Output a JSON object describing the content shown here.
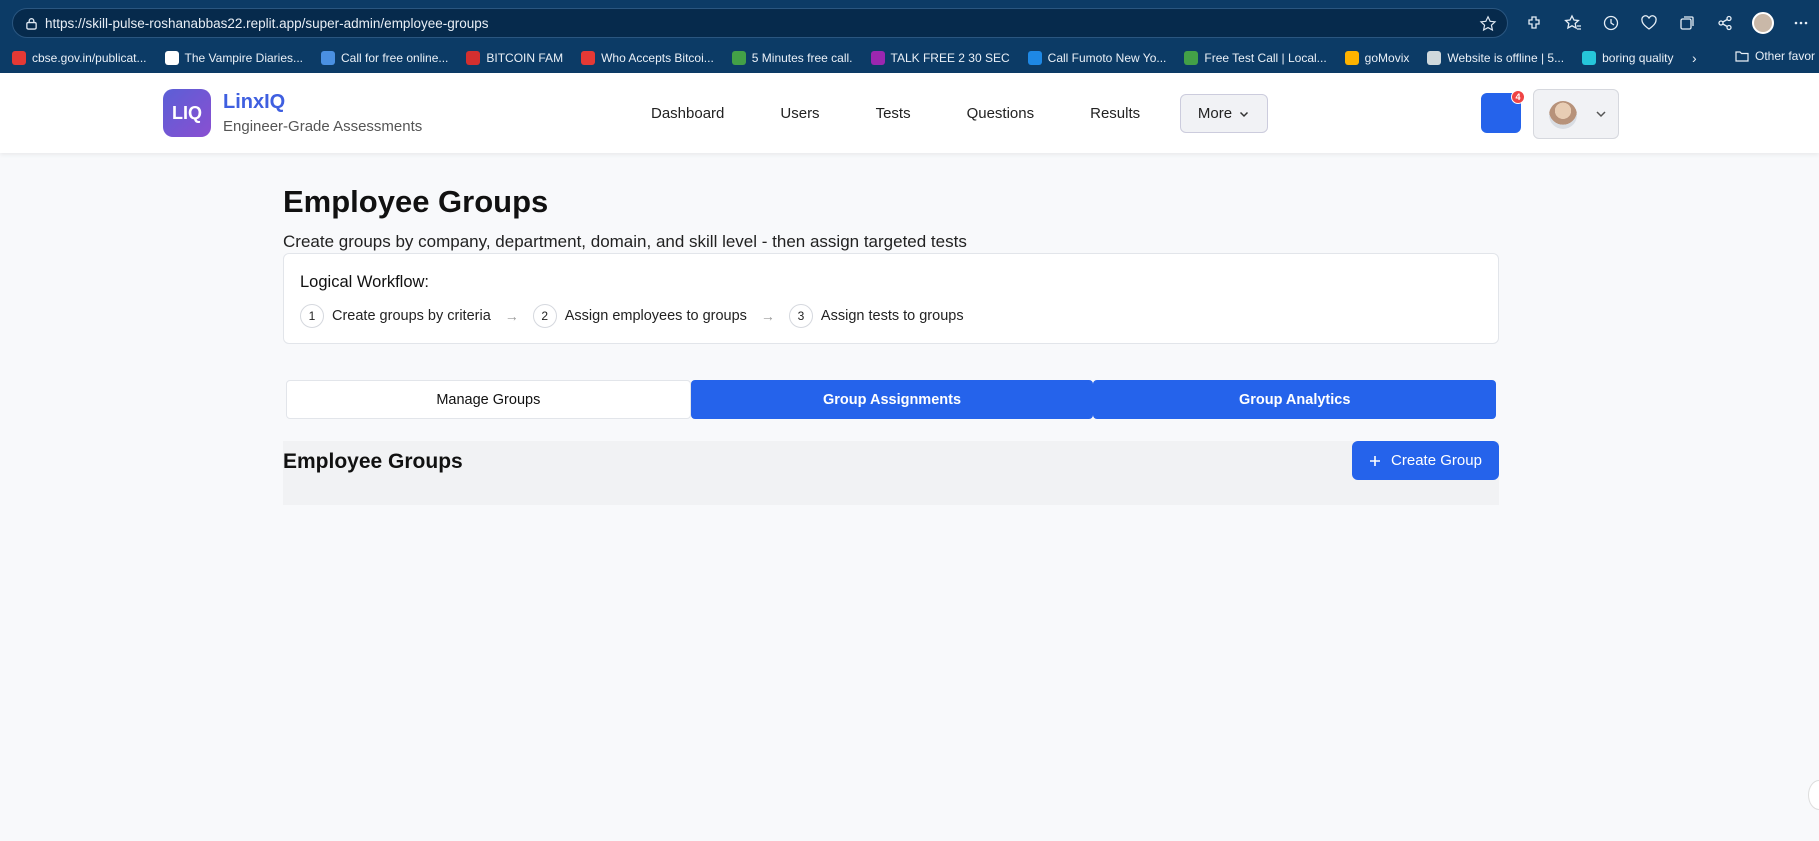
{
  "browser": {
    "url": "https://skill-pulse-roshanabbas22.replit.app/super-admin/employee-groups",
    "bookmarks": [
      {
        "label": "cbse.gov.in/publicat...",
        "color": "#e53935"
      },
      {
        "label": "The Vampire Diaries...",
        "color": "#ffffff"
      },
      {
        "label": "Call for free online...",
        "color": "#4a90e2"
      },
      {
        "label": "BITCOIN FAM",
        "color": "#d32f2f"
      },
      {
        "label": "Who Accepts Bitcoi...",
        "color": "#e53935"
      },
      {
        "label": "5 Minutes free call.",
        "color": "#43a047"
      },
      {
        "label": "TALK FREE 2 30 SEC",
        "color": "#9c27b0"
      },
      {
        "label": "Call Fumoto New Yo...",
        "color": "#1e88e5"
      },
      {
        "label": "Free Test Call | Local...",
        "color": "#43a047"
      },
      {
        "label": "goMovix",
        "color": "#ffb300"
      },
      {
        "label": "Website is offline | 5...",
        "color": "#cfd8dc"
      },
      {
        "label": "boring quality",
        "color": "#26c6da"
      }
    ],
    "other_favorites": "Other favor"
  },
  "header": {
    "logo_text": "LIQ",
    "brand": "LinxIQ",
    "tagline": "Engineer-Grade Assessments",
    "nav": [
      "Dashboard",
      "Users",
      "Tests",
      "Questions",
      "Results"
    ],
    "more_label": "More",
    "notification_count": "4"
  },
  "main": {
    "title": "Employee Groups",
    "subtitle": "Create groups by company, department, domain, and skill level - then assign targeted tests",
    "workflow": {
      "title": "Logical Workflow:",
      "steps": [
        {
          "num": "1",
          "label": "Create groups by criteria"
        },
        {
          "num": "2",
          "label": "Assign employees to groups"
        },
        {
          "num": "3",
          "label": "Assign tests to groups"
        }
      ],
      "arrow": "→"
    },
    "tabs": [
      "Manage Groups",
      "Group Assignments",
      "Group Analytics"
    ],
    "panel_title": "Employee Groups",
    "create_label": "Create Group"
  },
  "colors": {
    "primary": "#2563eb",
    "brand": "#3f5fe0",
    "browser_bar": "#0c3b66"
  }
}
